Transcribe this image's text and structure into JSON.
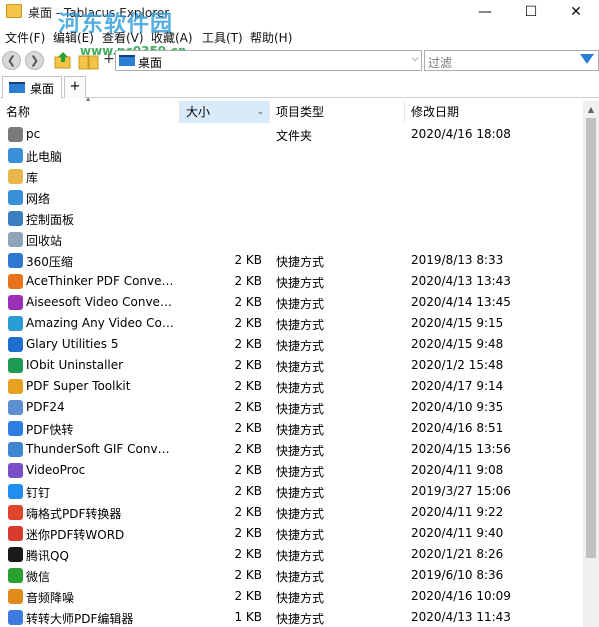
{
  "window": {
    "title": "桌面 - Tablacus Explorer",
    "minimize": "—",
    "maximize": "☐",
    "close": "✕"
  },
  "watermark": {
    "text": "河东软件园",
    "url": "www.pc0359.cn"
  },
  "menu": [
    "文件(F)",
    "编辑(E)",
    "查看(V)",
    "收藏(A)",
    "工具(T)",
    "帮助(H)"
  ],
  "toolbar": {
    "back": "❮",
    "forward": "❯",
    "plus": "+",
    "address": "桌面",
    "address_dropdown": "⌵",
    "filter_placeholder": "过滤"
  },
  "tabs": [
    {
      "label": "桌面"
    }
  ],
  "tab_add": "+",
  "columns": {
    "name": "名称",
    "size": "大小",
    "type": "项目类型",
    "date": "修改日期",
    "size_chevron": "⌄"
  },
  "colors": {
    "sorted_header": "#d9ebf9",
    "accent": "#2a7fd4"
  },
  "rows": [
    {
      "name": "pc",
      "size": "",
      "type": "文件夹",
      "date": "2020/4/16 18:08",
      "color": "#7a7a7a"
    },
    {
      "name": "此电脑",
      "size": "",
      "type": "",
      "date": "",
      "color": "#3a8fd9"
    },
    {
      "name": "库",
      "size": "",
      "type": "",
      "date": "",
      "color": "#e9b64a"
    },
    {
      "name": "网络",
      "size": "",
      "type": "",
      "date": "",
      "color": "#3a8fd9"
    },
    {
      "name": "控制面板",
      "size": "",
      "type": "",
      "date": "",
      "color": "#3a7fc0"
    },
    {
      "name": "回收站",
      "size": "",
      "type": "",
      "date": "",
      "color": "#8fa4b8"
    },
    {
      "name": "360压缩",
      "size": "2 KB",
      "type": "快捷方式",
      "date": "2019/8/13 8:33",
      "color": "#2e78d1"
    },
    {
      "name": "AceThinker PDF Converter",
      "size": "2 KB",
      "type": "快捷方式",
      "date": "2020/4/13 13:43",
      "color": "#e8731a"
    },
    {
      "name": "Aiseesoft Video Converter",
      "size": "2 KB",
      "type": "快捷方式",
      "date": "2020/4/14 13:45",
      "color": "#9a2fb8"
    },
    {
      "name": "Amazing Any Video Converter",
      "size": "2 KB",
      "type": "快捷方式",
      "date": "2020/4/15 9:15",
      "color": "#2a9dd6"
    },
    {
      "name": "Glary Utilities 5",
      "size": "2 KB",
      "type": "快捷方式",
      "date": "2020/4/15 9:48",
      "color": "#1f6fd0"
    },
    {
      "name": "IObit Uninstaller",
      "size": "2 KB",
      "type": "快捷方式",
      "date": "2020/1/2 15:48",
      "color": "#1e9a53"
    },
    {
      "name": "PDF Super Toolkit",
      "size": "2 KB",
      "type": "快捷方式",
      "date": "2020/4/17 9:14",
      "color": "#e8a020"
    },
    {
      "name": "PDF24",
      "size": "2 KB",
      "type": "快捷方式",
      "date": "2020/4/10 9:35",
      "color": "#5e8fd0"
    },
    {
      "name": "PDF快转",
      "size": "2 KB",
      "type": "快捷方式",
      "date": "2020/4/16 8:51",
      "color": "#2d7ee0"
    },
    {
      "name": "ThunderSoft GIF Converter",
      "size": "2 KB",
      "type": "快捷方式",
      "date": "2020/4/15 13:56",
      "color": "#3f86d2"
    },
    {
      "name": "VideoProc",
      "size": "2 KB",
      "type": "快捷方式",
      "date": "2020/4/11 9:08",
      "color": "#7a4fc8"
    },
    {
      "name": "钉钉",
      "size": "2 KB",
      "type": "快捷方式",
      "date": "2019/3/27 15:06",
      "color": "#1f8ef0"
    },
    {
      "name": "嗨格式PDF转换器",
      "size": "2 KB",
      "type": "快捷方式",
      "date": "2020/4/11 9:22",
      "color": "#e0442a"
    },
    {
      "name": "迷你PDF转WORD",
      "size": "2 KB",
      "type": "快捷方式",
      "date": "2020/4/11 9:40",
      "color": "#d93a2e"
    },
    {
      "name": "腾讯QQ",
      "size": "2 KB",
      "type": "快捷方式",
      "date": "2020/1/21 8:26",
      "color": "#1a1a1a"
    },
    {
      "name": "微信",
      "size": "2 KB",
      "type": "快捷方式",
      "date": "2019/6/10 8:36",
      "color": "#2aa12e"
    },
    {
      "name": "音频降噪",
      "size": "2 KB",
      "type": "快捷方式",
      "date": "2020/4/16 10:09",
      "color": "#e08a1a"
    },
    {
      "name": "转转大师PDF编辑器",
      "size": "1 KB",
      "type": "快捷方式",
      "date": "2020/4/13 11:43",
      "color": "#3d7be0"
    }
  ]
}
